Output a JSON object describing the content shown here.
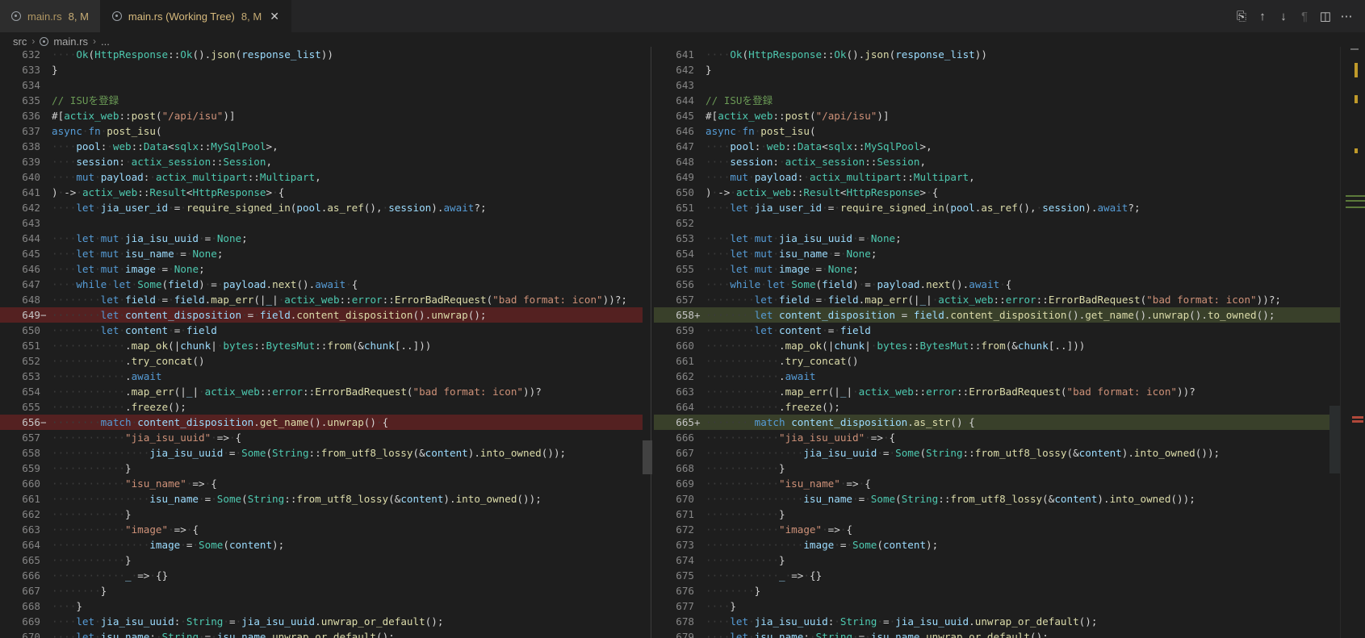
{
  "tabs": [
    {
      "label": "main.rs",
      "status": "8, M",
      "active": false
    },
    {
      "label": "main.rs (Working Tree)",
      "status": "8, M",
      "active": true
    }
  ],
  "toolbar": {
    "icons": [
      "open-file-icon",
      "arrow-up-icon",
      "arrow-down-icon",
      "pilcrow-icon",
      "split-editor-icon",
      "more-actions-icon"
    ]
  },
  "breadcrumb": [
    "src",
    "main.rs",
    "..."
  ],
  "colors": {
    "keyword": "#569cd6",
    "type": "#4ec9b0",
    "string": "#ce9178",
    "function": "#dcdcaa",
    "variable": "#9cdcfe",
    "comment": "#6a9955",
    "text": "#d4d4d4",
    "deleted_bg": "#5a1e1e",
    "added_bg": "#3a4a26"
  },
  "left": {
    "lines": [
      {
        "n": "632",
        "t": "    Ok(HttpResponse::Ok().json(response_list))"
      },
      {
        "n": "633",
        "t": "}"
      },
      {
        "n": "634",
        "t": ""
      },
      {
        "n": "635",
        "t": "// ISUを登録"
      },
      {
        "n": "636",
        "t": "#[actix_web::post(\"/api/isu\")]"
      },
      {
        "n": "637",
        "t": "async fn post_isu("
      },
      {
        "n": "638",
        "t": "    pool: web::Data<sqlx::MySqlPool>,"
      },
      {
        "n": "639",
        "t": "    session: actix_session::Session,"
      },
      {
        "n": "640",
        "t": "    mut payload: actix_multipart::Multipart,"
      },
      {
        "n": "641",
        "t": ") -> actix_web::Result<HttpResponse> {"
      },
      {
        "n": "642",
        "t": "    let jia_user_id = require_signed_in(pool.as_ref(), session).await?;"
      },
      {
        "n": "643",
        "t": ""
      },
      {
        "n": "644",
        "t": "    let mut jia_isu_uuid = None;"
      },
      {
        "n": "645",
        "t": "    let mut isu_name = None;"
      },
      {
        "n": "646",
        "t": "    let mut image = None;"
      },
      {
        "n": "647",
        "t": "    while let Some(field) = payload.next().await {"
      },
      {
        "n": "648",
        "t": "        let field = field.map_err(|_| actix_web::error::ErrorBadRequest(\"bad format: icon\"))?;"
      },
      {
        "n": "649",
        "t": "        let content_disposition = field.content_disposition().unwrap();",
        "k": "del"
      },
      {
        "n": "650",
        "t": "        let content = field"
      },
      {
        "n": "651",
        "t": "            .map_ok(|chunk| bytes::BytesMut::from(&chunk[..]))"
      },
      {
        "n": "652",
        "t": "            .try_concat()"
      },
      {
        "n": "653",
        "t": "            .await"
      },
      {
        "n": "654",
        "t": "            .map_err(|_| actix_web::error::ErrorBadRequest(\"bad format: icon\"))?"
      },
      {
        "n": "655",
        "t": "            .freeze();"
      },
      {
        "n": "656",
        "t": "        match content_disposition.get_name().unwrap() {",
        "k": "del"
      },
      {
        "n": "657",
        "t": "            \"jia_isu_uuid\" => {"
      },
      {
        "n": "658",
        "t": "                jia_isu_uuid = Some(String::from_utf8_lossy(&content).into_owned());"
      },
      {
        "n": "659",
        "t": "            }"
      },
      {
        "n": "660",
        "t": "            \"isu_name\" => {"
      },
      {
        "n": "661",
        "t": "                isu_name = Some(String::from_utf8_lossy(&content).into_owned());"
      },
      {
        "n": "662",
        "t": "            }"
      },
      {
        "n": "663",
        "t": "            \"image\" => {"
      },
      {
        "n": "664",
        "t": "                image = Some(content);"
      },
      {
        "n": "665",
        "t": "            }"
      },
      {
        "n": "666",
        "t": "            _ => {}"
      },
      {
        "n": "667",
        "t": "        }"
      },
      {
        "n": "668",
        "t": "    }"
      },
      {
        "n": "669",
        "t": "    let jia_isu_uuid: String = jia_isu_uuid.unwrap_or_default();"
      },
      {
        "n": "670",
        "t": "    let isu_name: String = isu_name.unwrap_or_default();"
      }
    ]
  },
  "right": {
    "lines": [
      {
        "n": "641",
        "t": "    Ok(HttpResponse::Ok().json(response_list))"
      },
      {
        "n": "642",
        "t": "}"
      },
      {
        "n": "643",
        "t": ""
      },
      {
        "n": "644",
        "t": "// ISUを登録"
      },
      {
        "n": "645",
        "t": "#[actix_web::post(\"/api/isu\")]"
      },
      {
        "n": "646",
        "t": "async fn post_isu("
      },
      {
        "n": "647",
        "t": "    pool: web::Data<sqlx::MySqlPool>,"
      },
      {
        "n": "648",
        "t": "    session: actix_session::Session,"
      },
      {
        "n": "649",
        "t": "    mut payload: actix_multipart::Multipart,"
      },
      {
        "n": "650",
        "t": ") -> actix_web::Result<HttpResponse> {"
      },
      {
        "n": "651",
        "t": "    let jia_user_id = require_signed_in(pool.as_ref(), session).await?;"
      },
      {
        "n": "652",
        "t": ""
      },
      {
        "n": "653",
        "t": "    let mut jia_isu_uuid = None;"
      },
      {
        "n": "654",
        "t": "    let mut isu_name = None;"
      },
      {
        "n": "655",
        "t": "    let mut image = None;"
      },
      {
        "n": "656",
        "t": "    while let Some(field) = payload.next().await {"
      },
      {
        "n": "657",
        "t": "        let field = field.map_err(|_| actix_web::error::ErrorBadRequest(\"bad format: icon\"))?;"
      },
      {
        "n": "658",
        "t": "        let content_disposition = field.content_disposition().get_name().unwrap().to_owned();",
        "k": "add"
      },
      {
        "n": "659",
        "t": "        let content = field"
      },
      {
        "n": "660",
        "t": "            .map_ok(|chunk| bytes::BytesMut::from(&chunk[..]))"
      },
      {
        "n": "661",
        "t": "            .try_concat()"
      },
      {
        "n": "662",
        "t": "            .await"
      },
      {
        "n": "663",
        "t": "            .map_err(|_| actix_web::error::ErrorBadRequest(\"bad format: icon\"))?"
      },
      {
        "n": "664",
        "t": "            .freeze();"
      },
      {
        "n": "665",
        "t": "        match content_disposition.as_str() {",
        "k": "add"
      },
      {
        "n": "666",
        "t": "            \"jia_isu_uuid\" => {"
      },
      {
        "n": "667",
        "t": "                jia_isu_uuid = Some(String::from_utf8_lossy(&content).into_owned());"
      },
      {
        "n": "668",
        "t": "            }"
      },
      {
        "n": "669",
        "t": "            \"isu_name\" => {"
      },
      {
        "n": "670",
        "t": "                isu_name = Some(String::from_utf8_lossy(&content).into_owned());"
      },
      {
        "n": "671",
        "t": "            }"
      },
      {
        "n": "672",
        "t": "            \"image\" => {"
      },
      {
        "n": "673",
        "t": "                image = Some(content);"
      },
      {
        "n": "674",
        "t": "            }"
      },
      {
        "n": "675",
        "t": "            _ => {}"
      },
      {
        "n": "676",
        "t": "        }"
      },
      {
        "n": "677",
        "t": "    }"
      },
      {
        "n": "678",
        "t": "    let jia_isu_uuid: String = jia_isu_uuid.unwrap_or_default();"
      },
      {
        "n": "679",
        "t": "    let isu_name: String = isu_name.unwrap_or_default();"
      }
    ]
  }
}
